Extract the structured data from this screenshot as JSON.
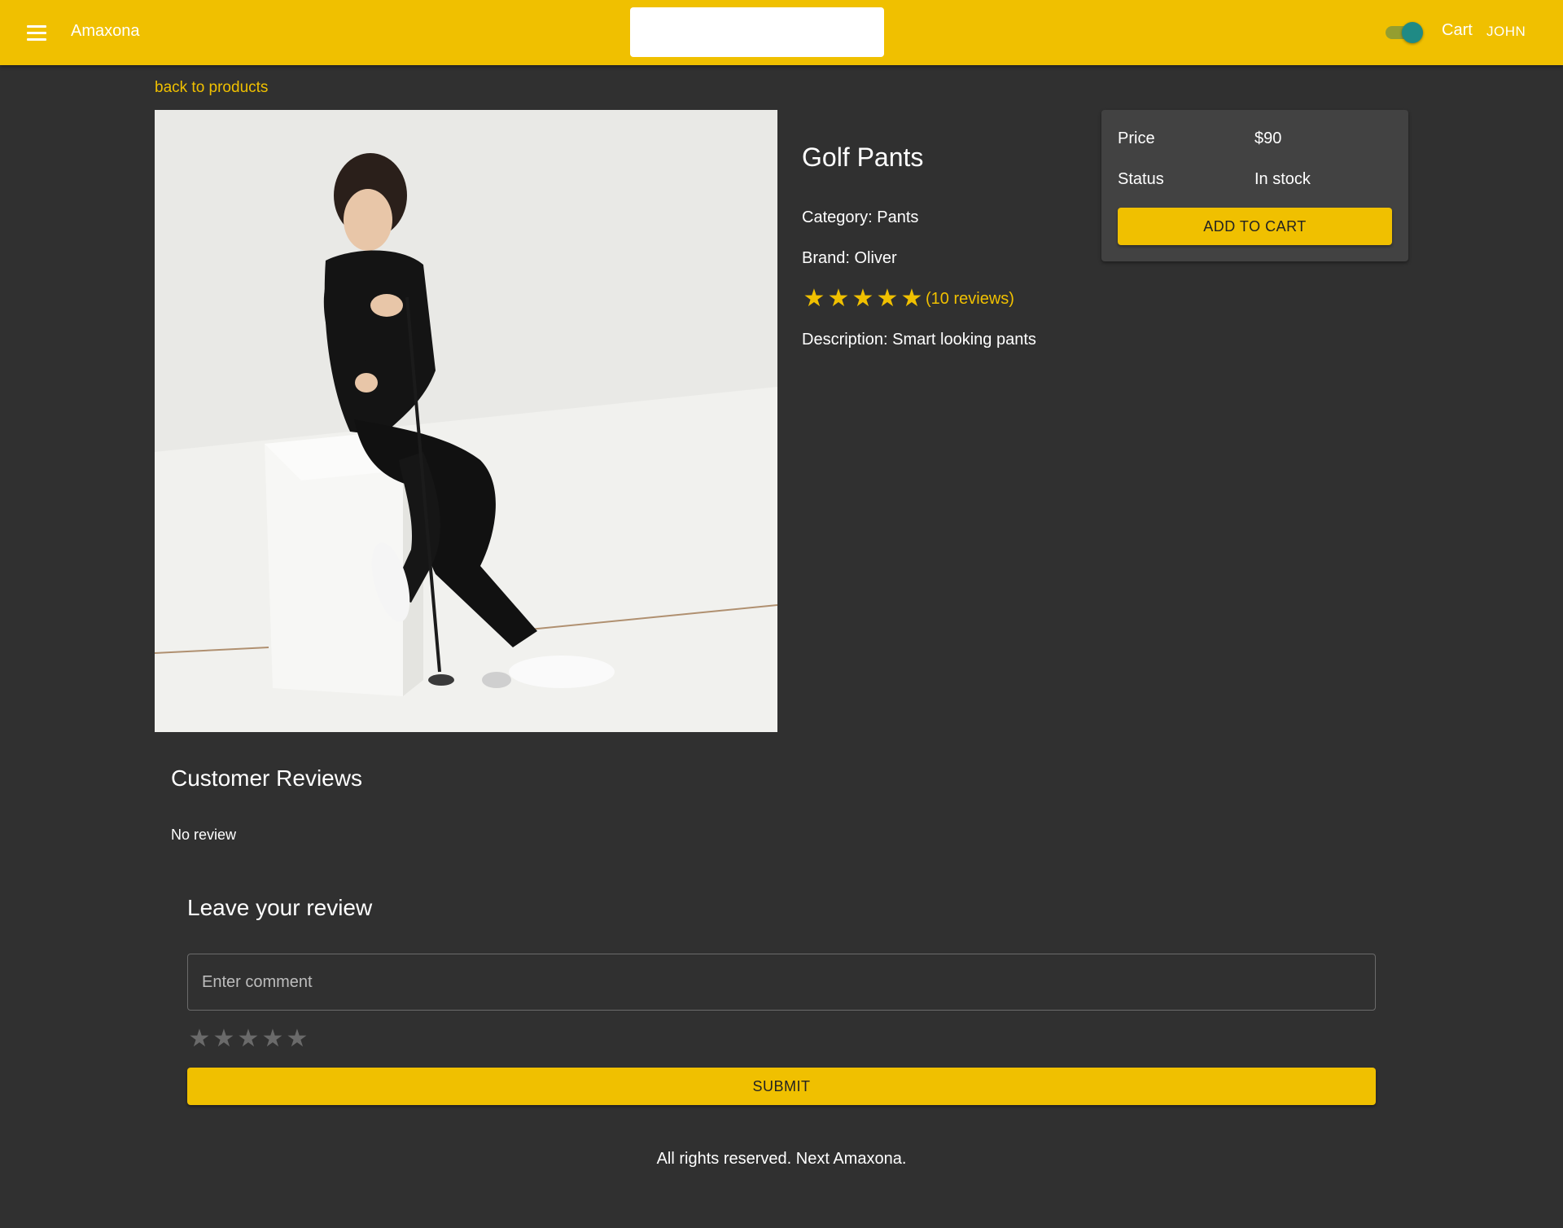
{
  "header": {
    "menu_icon": "hamburger-menu-icon",
    "brand": "Amaxona",
    "search": {
      "value": "",
      "placeholder": ""
    },
    "theme_toggle": {
      "on": true,
      "track_color": "#8a9a35",
      "thumb_color": "#1f8a85"
    },
    "cart_label": "Cart",
    "user_label": "JOHN",
    "bar_color": "#f0c000"
  },
  "back_link": "back to products",
  "product": {
    "image_alt": "Golf Pants",
    "name": "Golf Pants",
    "category": "Category: Pants",
    "brand": "Brand: Oliver",
    "rating": 5,
    "reviews_label": "(10 reviews)",
    "description": "Description: Smart looking pants"
  },
  "price_card": {
    "price_label": "Price",
    "price_value": "$90",
    "status_label": "Status",
    "status_value": "In stock",
    "add_button": "ADD TO CART"
  },
  "reviews": {
    "title": "Customer Reviews",
    "empty_text": "No review"
  },
  "review_form": {
    "title": "Leave your review",
    "comment_value": "",
    "comment_placeholder": "Enter comment",
    "rating": 0,
    "submit_label": "SUBMIT"
  },
  "footer": "All rights reserved. Next Amaxona.",
  "colors": {
    "accent": "#f0c000",
    "background": "#303030",
    "card": "#424242"
  }
}
